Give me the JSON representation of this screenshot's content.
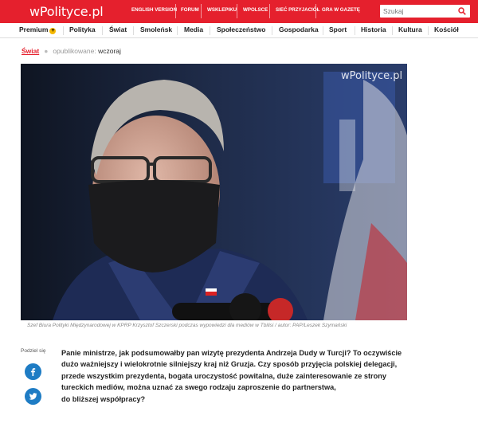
{
  "header": {
    "logo": "wPolityce.pl",
    "links": [
      "ENGLISH VERSION",
      "FORUM",
      "WSKLEPIKU",
      "WPOLSCE",
      "SIEĆ PRZYJACIÓŁ",
      "GRA W GAZETĘ"
    ],
    "search_placeholder": "Szukaj"
  },
  "nav": {
    "premium": "Premium",
    "items": [
      "Polityka",
      "Świat",
      "Smoleńsk",
      "Media",
      "Społeczeństwo",
      "Gospodarka",
      "Sport",
      "Historia",
      "Kultura",
      "Kościół"
    ]
  },
  "article": {
    "category": "Świat",
    "published_label": "opublikowane:",
    "published_value": "wczoraj",
    "photo_watermark": "wPolityce.pl",
    "caption": "Szef Biura Polityki Międzynarodowej w KPRP Krzysztof Szczerski podczas wypowiedzi dla mediów w Tbilisi / autor: PAP/Leszek Szymański",
    "share_label": "Podziel się",
    "lead_lines": [
      "Panie ministrze, jak podsumowałby pan wizytę prezydenta Andrzeja Dudy w Turcji? To oczywiście",
      "dużo ważniejszy i wielokrotnie silniejszy kraj niż Gruzja. Czy sposób przyjęcia polskiej delegacji,",
      "przede wszystkim prezydenta, bogata uroczystość powitalna, duże zainteresowanie ze strony",
      "tureckich mediów, można uznać za swego rodzaju zaproszenie do partnerstwa,",
      "do bliższej współpracy?"
    ]
  },
  "colors": {
    "brand": "#e5202d",
    "premium_badge": "#f5b800",
    "share": "#1e7cc4"
  }
}
